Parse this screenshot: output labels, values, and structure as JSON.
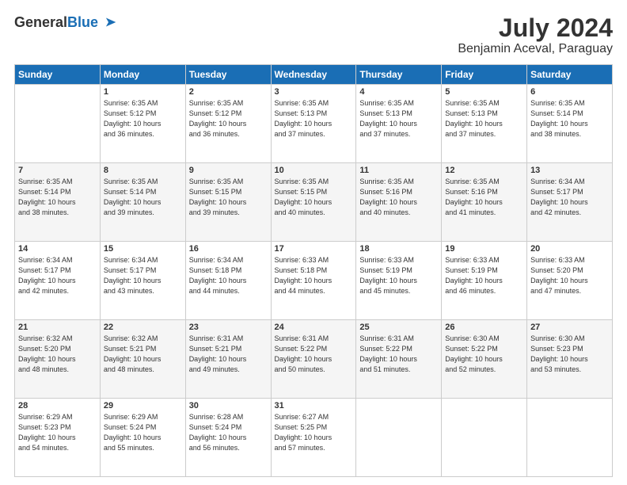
{
  "logo": {
    "line1": "General",
    "line2": "Blue"
  },
  "title": "July 2024",
  "subtitle": "Benjamin Aceval, Paraguay",
  "weekdays": [
    "Sunday",
    "Monday",
    "Tuesday",
    "Wednesday",
    "Thursday",
    "Friday",
    "Saturday"
  ],
  "weeks": [
    [
      {
        "day": "",
        "info": ""
      },
      {
        "day": "1",
        "info": "Sunrise: 6:35 AM\nSunset: 5:12 PM\nDaylight: 10 hours\nand 36 minutes."
      },
      {
        "day": "2",
        "info": "Sunrise: 6:35 AM\nSunset: 5:12 PM\nDaylight: 10 hours\nand 36 minutes."
      },
      {
        "day": "3",
        "info": "Sunrise: 6:35 AM\nSunset: 5:13 PM\nDaylight: 10 hours\nand 37 minutes."
      },
      {
        "day": "4",
        "info": "Sunrise: 6:35 AM\nSunset: 5:13 PM\nDaylight: 10 hours\nand 37 minutes."
      },
      {
        "day": "5",
        "info": "Sunrise: 6:35 AM\nSunset: 5:13 PM\nDaylight: 10 hours\nand 37 minutes."
      },
      {
        "day": "6",
        "info": "Sunrise: 6:35 AM\nSunset: 5:14 PM\nDaylight: 10 hours\nand 38 minutes."
      }
    ],
    [
      {
        "day": "7",
        "info": "Sunrise: 6:35 AM\nSunset: 5:14 PM\nDaylight: 10 hours\nand 38 minutes."
      },
      {
        "day": "8",
        "info": "Sunrise: 6:35 AM\nSunset: 5:14 PM\nDaylight: 10 hours\nand 39 minutes."
      },
      {
        "day": "9",
        "info": "Sunrise: 6:35 AM\nSunset: 5:15 PM\nDaylight: 10 hours\nand 39 minutes."
      },
      {
        "day": "10",
        "info": "Sunrise: 6:35 AM\nSunset: 5:15 PM\nDaylight: 10 hours\nand 40 minutes."
      },
      {
        "day": "11",
        "info": "Sunrise: 6:35 AM\nSunset: 5:16 PM\nDaylight: 10 hours\nand 40 minutes."
      },
      {
        "day": "12",
        "info": "Sunrise: 6:35 AM\nSunset: 5:16 PM\nDaylight: 10 hours\nand 41 minutes."
      },
      {
        "day": "13",
        "info": "Sunrise: 6:34 AM\nSunset: 5:17 PM\nDaylight: 10 hours\nand 42 minutes."
      }
    ],
    [
      {
        "day": "14",
        "info": "Sunrise: 6:34 AM\nSunset: 5:17 PM\nDaylight: 10 hours\nand 42 minutes."
      },
      {
        "day": "15",
        "info": "Sunrise: 6:34 AM\nSunset: 5:17 PM\nDaylight: 10 hours\nand 43 minutes."
      },
      {
        "day": "16",
        "info": "Sunrise: 6:34 AM\nSunset: 5:18 PM\nDaylight: 10 hours\nand 44 minutes."
      },
      {
        "day": "17",
        "info": "Sunrise: 6:33 AM\nSunset: 5:18 PM\nDaylight: 10 hours\nand 44 minutes."
      },
      {
        "day": "18",
        "info": "Sunrise: 6:33 AM\nSunset: 5:19 PM\nDaylight: 10 hours\nand 45 minutes."
      },
      {
        "day": "19",
        "info": "Sunrise: 6:33 AM\nSunset: 5:19 PM\nDaylight: 10 hours\nand 46 minutes."
      },
      {
        "day": "20",
        "info": "Sunrise: 6:33 AM\nSunset: 5:20 PM\nDaylight: 10 hours\nand 47 minutes."
      }
    ],
    [
      {
        "day": "21",
        "info": "Sunrise: 6:32 AM\nSunset: 5:20 PM\nDaylight: 10 hours\nand 48 minutes."
      },
      {
        "day": "22",
        "info": "Sunrise: 6:32 AM\nSunset: 5:21 PM\nDaylight: 10 hours\nand 48 minutes."
      },
      {
        "day": "23",
        "info": "Sunrise: 6:31 AM\nSunset: 5:21 PM\nDaylight: 10 hours\nand 49 minutes."
      },
      {
        "day": "24",
        "info": "Sunrise: 6:31 AM\nSunset: 5:22 PM\nDaylight: 10 hours\nand 50 minutes."
      },
      {
        "day": "25",
        "info": "Sunrise: 6:31 AM\nSunset: 5:22 PM\nDaylight: 10 hours\nand 51 minutes."
      },
      {
        "day": "26",
        "info": "Sunrise: 6:30 AM\nSunset: 5:22 PM\nDaylight: 10 hours\nand 52 minutes."
      },
      {
        "day": "27",
        "info": "Sunrise: 6:30 AM\nSunset: 5:23 PM\nDaylight: 10 hours\nand 53 minutes."
      }
    ],
    [
      {
        "day": "28",
        "info": "Sunrise: 6:29 AM\nSunset: 5:23 PM\nDaylight: 10 hours\nand 54 minutes."
      },
      {
        "day": "29",
        "info": "Sunrise: 6:29 AM\nSunset: 5:24 PM\nDaylight: 10 hours\nand 55 minutes."
      },
      {
        "day": "30",
        "info": "Sunrise: 6:28 AM\nSunset: 5:24 PM\nDaylight: 10 hours\nand 56 minutes."
      },
      {
        "day": "31",
        "info": "Sunrise: 6:27 AM\nSunset: 5:25 PM\nDaylight: 10 hours\nand 57 minutes."
      },
      {
        "day": "",
        "info": ""
      },
      {
        "day": "",
        "info": ""
      },
      {
        "day": "",
        "info": ""
      }
    ]
  ],
  "rowBg": [
    "row-bg-white",
    "row-bg-light",
    "row-bg-white",
    "row-bg-light",
    "row-bg-white"
  ]
}
